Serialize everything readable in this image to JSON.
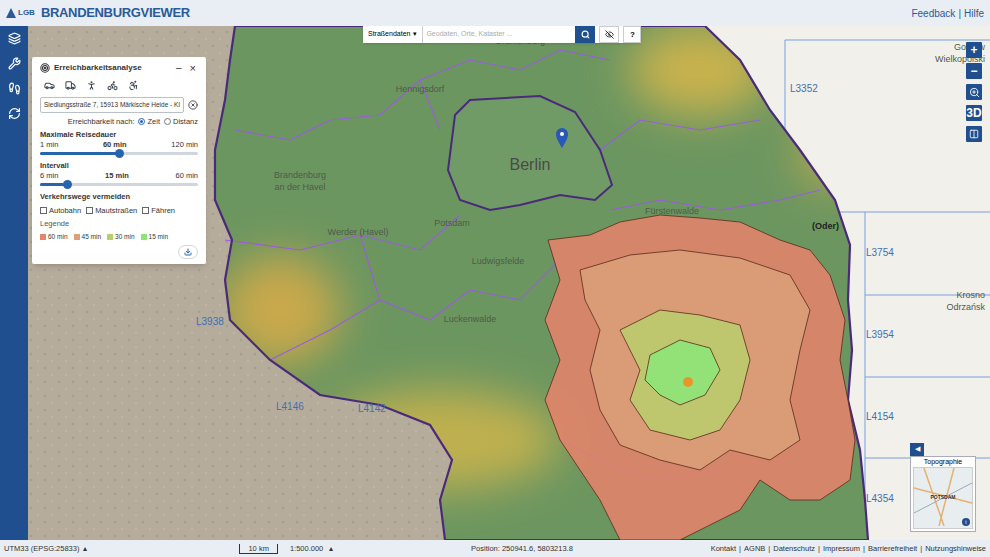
{
  "header": {
    "logo": "LGB",
    "title": "BRANDENBURGVIEWER",
    "links": [
      "Feedback",
      "Hilfe"
    ],
    "separator": "|"
  },
  "sidebar": {
    "items": [
      {
        "kind": "layers"
      },
      {
        "kind": "tools"
      },
      {
        "kind": "route"
      },
      {
        "kind": "refresh"
      }
    ]
  },
  "search": {
    "layer": "Straßendaten",
    "caret": "▾",
    "placeholder": "Geodaten, Orte, Kataster ...",
    "help": "?"
  },
  "map_controls": {
    "zoom_in": "+",
    "zoom_out": "−",
    "three_d": "3D"
  },
  "panel": {
    "title": "Erreichbarkeitsanalyse",
    "minimize": "–",
    "close": "×",
    "modes": [
      {
        "kind": "car"
      },
      {
        "kind": "truck"
      },
      {
        "kind": "walk"
      },
      {
        "kind": "bike"
      },
      {
        "kind": "wheelchair"
      }
    ],
    "address": "Siedlungsstraße 7, 15913 Märkische Heide - Kl",
    "criterion_label": "Erreichbarkeit nach:",
    "criteria": [
      {
        "label": "Zeit",
        "selected": true
      },
      {
        "label": "Distanz",
        "selected": false
      }
    ],
    "sliders": [
      {
        "label": "Maximale Reisedauer",
        "min": "1 min",
        "value": "60 min",
        "max": "120 min",
        "level": 0.5
      },
      {
        "label": "Intervall",
        "min": "6 min",
        "value": "15 min",
        "max": "60 min",
        "level": 0.17
      }
    ],
    "avoid_label": "Verkehrswege vermeiden",
    "avoid": [
      {
        "label": "Autobahn",
        "checked": false
      },
      {
        "label": "Mautstraßen",
        "checked": false
      },
      {
        "label": "Fähren",
        "checked": false
      }
    ],
    "legend_label": "Legende",
    "legend": [
      {
        "label": "60 min",
        "color": "#e8836b"
      },
      {
        "label": "45 min",
        "color": "#d9a07a"
      },
      {
        "label": "30 min",
        "color": "#b8cf6b"
      },
      {
        "label": "15 min",
        "color": "#8be67a"
      }
    ]
  },
  "map_labels": {
    "main": "Berlin",
    "places": [
      "Oranienburg",
      "Hennigsdorf",
      "Brandenburg",
      "an der Havel",
      "Potsdam",
      "Werder (Havel)",
      "Ludwigsfelde",
      "Fürstenwalde",
      "Luckenwalde",
      "(Oder)",
      "Gorzów",
      "Wielkopolski",
      "Krosno",
      "Odrzańsk"
    ],
    "roads": [
      "L3352",
      "L3754",
      "L3954",
      "L4154",
      "L4354",
      "L4146",
      "L4142",
      "L3938"
    ]
  },
  "minimap": {
    "title": "Topographie",
    "label": "POTSDAM",
    "toggle": "◀",
    "info": "i"
  },
  "status_bar": {
    "crs": "UTM33 (EPSG:25833)",
    "caret": "▴",
    "scale_bar": "10 km",
    "scale": "1:500.000",
    "position": "Position: 250941.6, 5803213.8",
    "links": [
      "Kontakt",
      "AGNB",
      "Datenschutz",
      "Impressum",
      "Barrierefreiheit",
      "Nutzungshinweise"
    ],
    "separator": "|"
  }
}
